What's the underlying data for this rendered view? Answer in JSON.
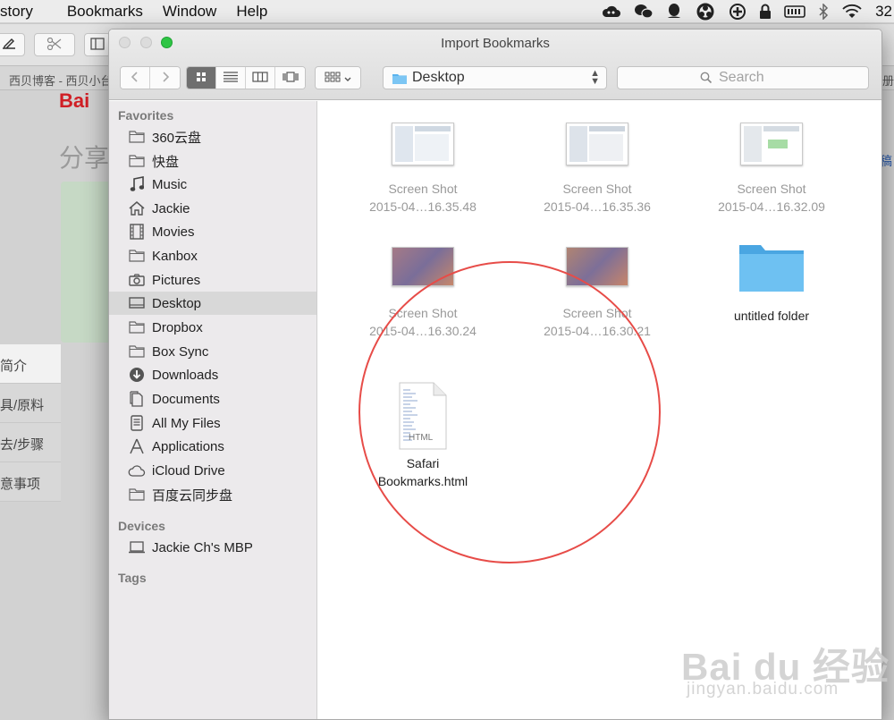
{
  "menubar": {
    "items": [
      "story",
      "Bookmarks",
      "Window",
      "Help"
    ],
    "clock": "32"
  },
  "background": {
    "tab_left": "西贝博客 - 西贝小台",
    "tab_right": "注册",
    "logo": "Bai",
    "page_title": "分享",
    "right_text": "稿",
    "side_menu": [
      "简介",
      "具/原料",
      "去/步骤",
      "意事项"
    ]
  },
  "dialog": {
    "title": "Import Bookmarks",
    "location": "Desktop",
    "search_placeholder": "Search"
  },
  "sidebar": {
    "favorites_header": "Favorites",
    "favorites": [
      {
        "label": "360云盘",
        "icon": "folder-icon"
      },
      {
        "label": "快盘",
        "icon": "folder-icon"
      },
      {
        "label": "Music",
        "icon": "music-icon"
      },
      {
        "label": "Jackie",
        "icon": "home-icon"
      },
      {
        "label": "Movies",
        "icon": "film-icon"
      },
      {
        "label": "Kanbox",
        "icon": "folder-icon"
      },
      {
        "label": "Pictures",
        "icon": "camera-icon"
      },
      {
        "label": "Desktop",
        "icon": "desktop-icon"
      },
      {
        "label": "Dropbox",
        "icon": "folder-icon"
      },
      {
        "label": "Box Sync",
        "icon": "folder-icon"
      },
      {
        "label": "Downloads",
        "icon": "download-icon"
      },
      {
        "label": "Documents",
        "icon": "documents-icon"
      },
      {
        "label": "All My Files",
        "icon": "all-files-icon"
      },
      {
        "label": "Applications",
        "icon": "applications-icon"
      },
      {
        "label": "iCloud Drive",
        "icon": "cloud-icon"
      },
      {
        "label": "百度云同步盘",
        "icon": "folder-icon"
      }
    ],
    "devices_header": "Devices",
    "devices": [
      {
        "label": "Jackie Ch's MBP",
        "icon": "laptop-icon"
      }
    ],
    "tags_header": "Tags"
  },
  "files": [
    {
      "line1": "Screen Shot",
      "line2": "2015-04…16.35.48",
      "kind": "screenshot"
    },
    {
      "line1": "Screen Shot",
      "line2": "2015-04…16.35.36",
      "kind": "screenshot"
    },
    {
      "line1": "Screen Shot",
      "line2": "2015-04…16.32.09",
      "kind": "screenshot"
    },
    {
      "line1": "Screen Shot",
      "line2": "2015-04…16.30.24",
      "kind": "screenshot"
    },
    {
      "line1": "Screen Shot",
      "line2": "2015-04…16.30.21",
      "kind": "screenshot"
    },
    {
      "line1": "untitled folder",
      "line2": "",
      "kind": "folder"
    },
    {
      "line1": "Safari",
      "line2": "Bookmarks.html",
      "kind": "html",
      "badge": "HTML"
    }
  ],
  "watermark": {
    "main": "Bai du 经验",
    "sub": "jingyan.baidu.com"
  },
  "colors": {
    "selection": "#d8d8d8",
    "folder_blue": "#5ab4ee",
    "annotation_red": "#e74c48",
    "zoom_green": "#2ec544"
  }
}
